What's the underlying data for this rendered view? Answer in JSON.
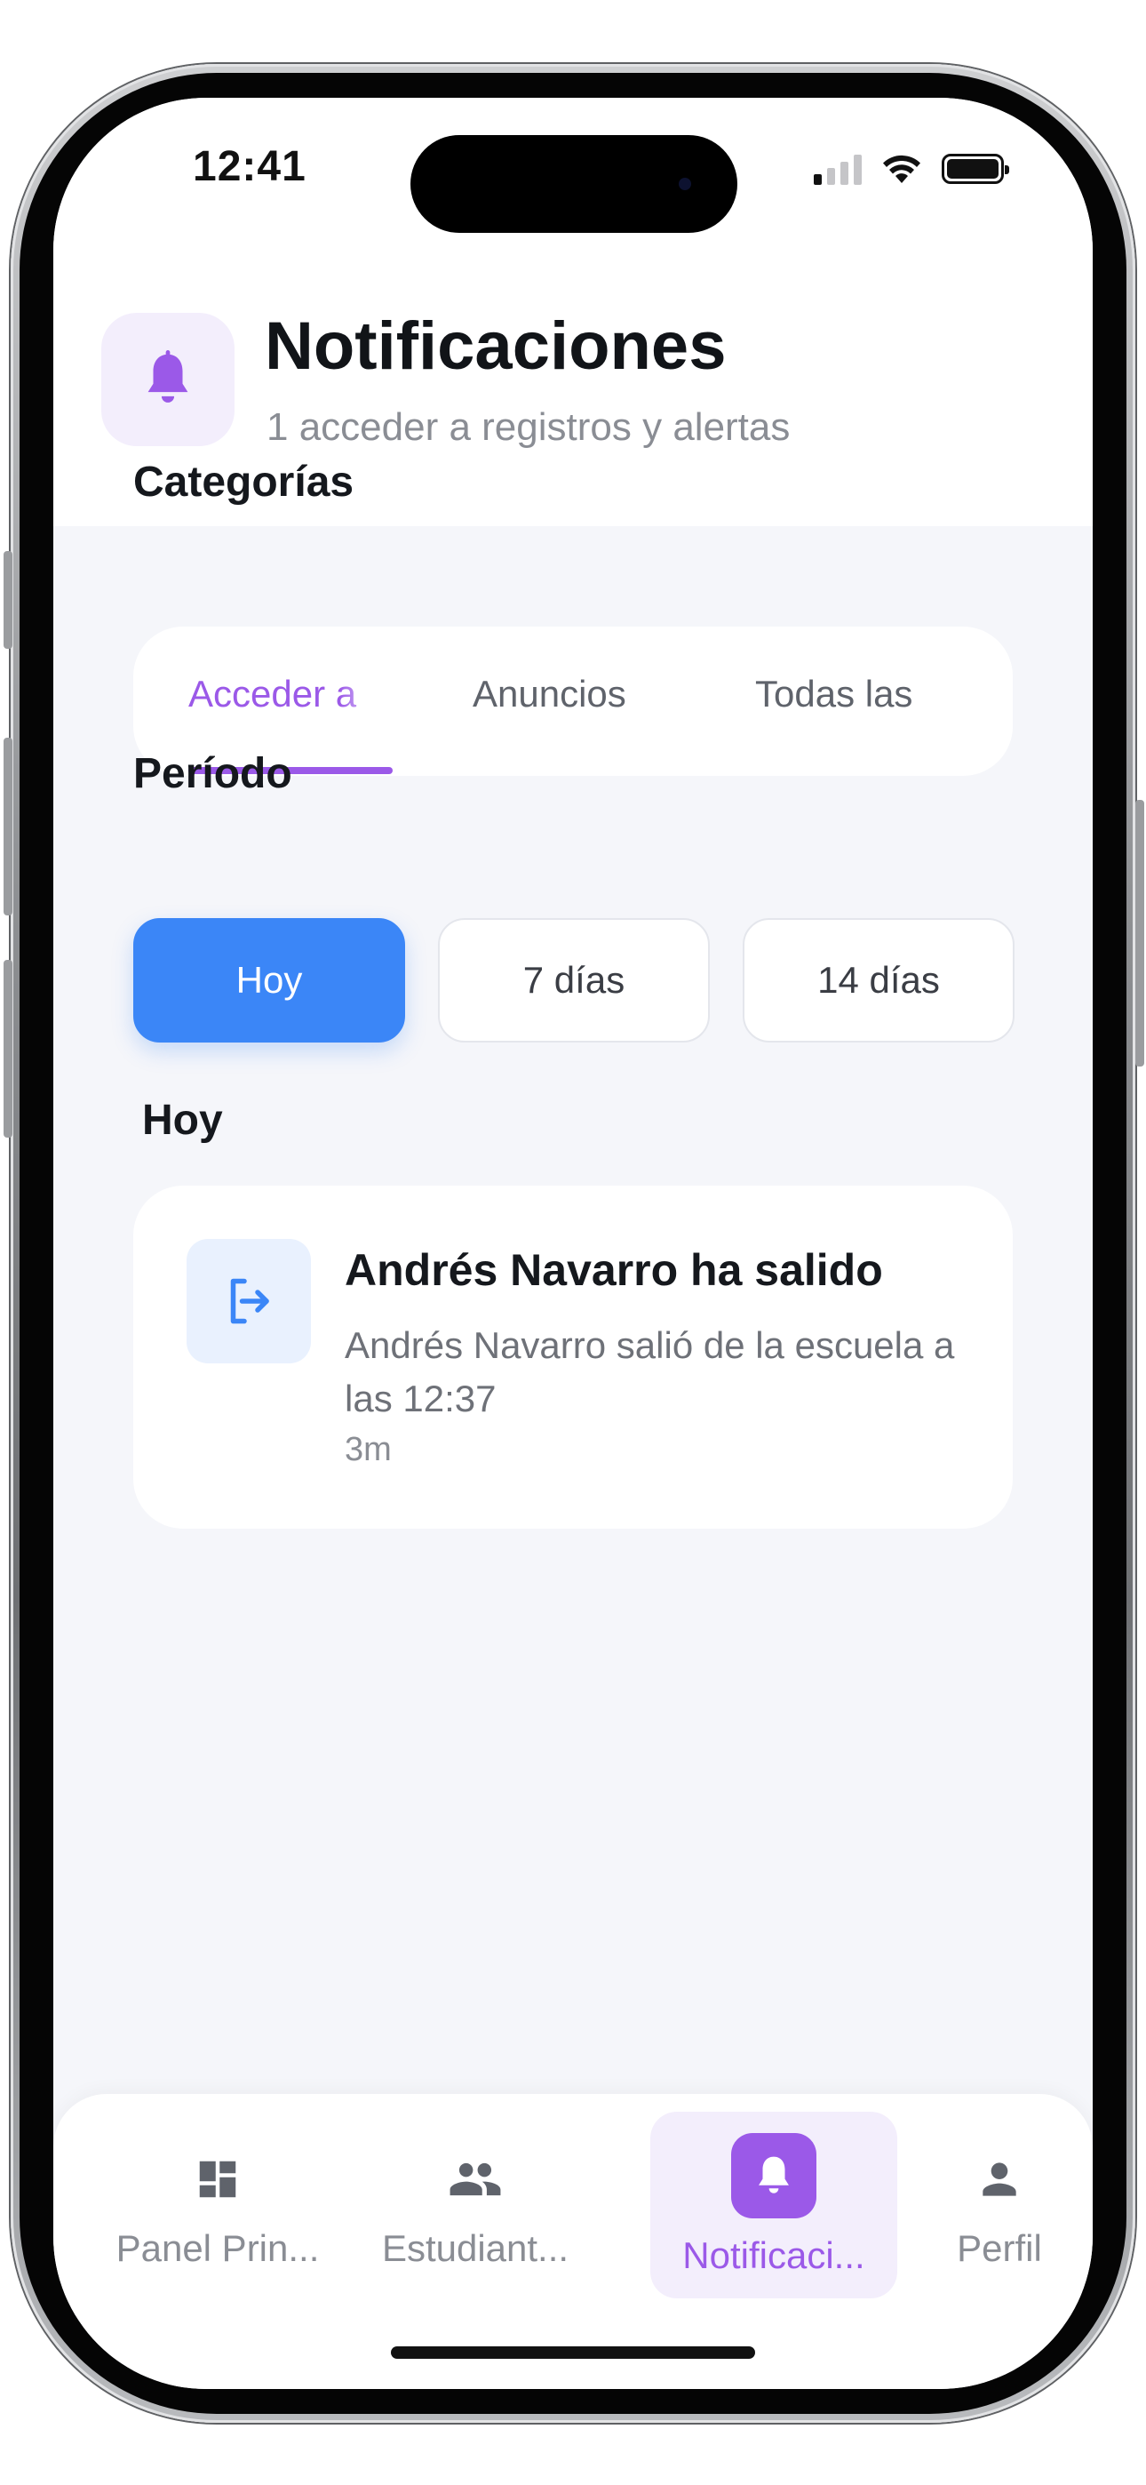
{
  "status_bar": {
    "time": "12:41"
  },
  "header": {
    "icon": "bell-icon",
    "title": "Notificaciones",
    "subtitle": "1 acceder a registros y alertas"
  },
  "categories": {
    "label": "Categorías",
    "tabs": [
      {
        "label": "Acceder a",
        "active": true
      },
      {
        "label": "Anuncios",
        "active": false
      },
      {
        "label": "Todas las",
        "active": false
      }
    ]
  },
  "period": {
    "label": "Período",
    "options": [
      {
        "label": "Hoy",
        "active": true
      },
      {
        "label": "7 días",
        "active": false
      },
      {
        "label": "14 días",
        "active": false
      }
    ]
  },
  "group": {
    "label": "Hoy"
  },
  "notifications": [
    {
      "icon": "logout-icon",
      "title": "Andrés Navarro ha salido",
      "body": "Andrés Navarro salió de la escuela a las 12:37",
      "time": "3m"
    }
  ],
  "bottom_nav": [
    {
      "label": "Panel Prin...",
      "icon": "dashboard-icon",
      "active": false
    },
    {
      "label": "Estudiant...",
      "icon": "people-icon",
      "active": false
    },
    {
      "label": "Notificaci...",
      "icon": "bell-icon",
      "active": true
    },
    {
      "label": "Perfil",
      "icon": "person-icon",
      "active": false
    }
  ],
  "colors": {
    "accent_purple": "#9b59e8",
    "accent_blue": "#3b86f7",
    "background": "#f5f6fa"
  }
}
